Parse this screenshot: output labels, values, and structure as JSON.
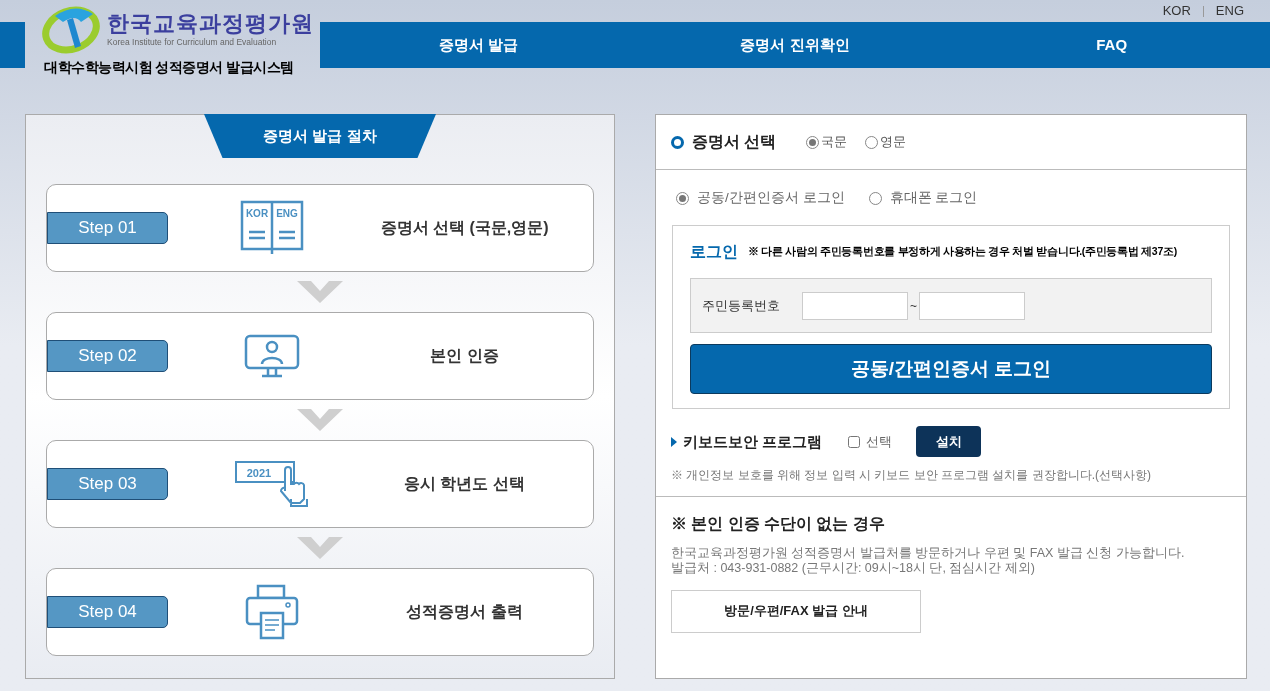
{
  "header": {
    "languages": [
      "KOR",
      "ENG"
    ],
    "logo": {
      "name_ko": "한국교육과정평가원",
      "name_en": "Korea Institute for Curriculum and Evaluation",
      "system": "대학수학능력시험 성적증명서 발급시스템"
    },
    "nav": [
      "증명서 발급",
      "증명서 진위확인",
      "FAQ"
    ]
  },
  "procedure": {
    "title": "증명서 발급 절차",
    "steps": [
      {
        "label": "Step 01",
        "kind": "book",
        "icon_texts": [
          "KOR",
          "ENG"
        ],
        "text": "증명서 선택 (국문,영문)"
      },
      {
        "label": "Step 02",
        "kind": "monitor",
        "text": "본인 인증"
      },
      {
        "label": "Step 03",
        "kind": "year",
        "icon_texts": [
          "2021"
        ],
        "text": "응시 학년도 선택"
      },
      {
        "label": "Step 04",
        "kind": "printer",
        "text": "성적증명서 출력"
      }
    ]
  },
  "certificate": {
    "title": "증명서 선택",
    "options": [
      {
        "label": "국문",
        "selected": true
      },
      {
        "label": "영문",
        "selected": false
      }
    ]
  },
  "login_methods": [
    {
      "label": "공동/간편인증서 로그인",
      "selected": true
    },
    {
      "label": "휴대폰 로그인",
      "selected": false
    }
  ],
  "login": {
    "title": "로그인",
    "warning": "※ 다른 사람의 주민등록번호를 부정하게 사용하는 경우 처벌 받습니다.(주민등록법 제37조)",
    "id_label": "주민등록번호",
    "separator": "~",
    "button": "공동/간편인증서 로그인"
  },
  "keyboard": {
    "title": "키보드보안 프로그램",
    "checkbox": {
      "label": "선택",
      "checked": false
    },
    "button": "설치",
    "note": "※ 개인정보 보호를 위해 정보 입력 시 키보드 보안 프로그램 설치를 권장합니다.(선택사항)"
  },
  "no_auth": {
    "title": "※ 본인 인증 수단이 없는 경우",
    "lines": [
      "한국교육과정평가원 성적증명서 발급처를 방문하거나 우편 및 FAX 발급 신청 가능합니다.",
      "발급처 : 043-931-0882 (근무시간: 09시~18시 단, 점심시간 제외)"
    ],
    "button": "방문/우편/FAX 발급 안내"
  }
}
